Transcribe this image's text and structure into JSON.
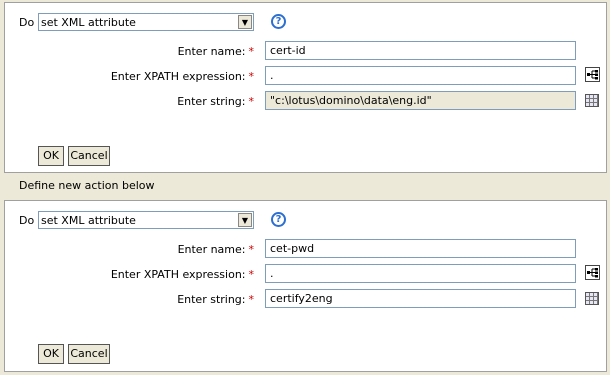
{
  "actions": [
    {
      "do_label": "Do",
      "selected_action": "set XML attribute",
      "help_glyph": "?",
      "fields": {
        "name_label": "Enter name:",
        "name_value": "cert-id",
        "xpath_label": "Enter XPATH expression:",
        "xpath_value": ".",
        "string_label": "Enter string:",
        "string_value": "\"c:\\lotus\\domino\\data\\eng.id\""
      },
      "required_mark": "*",
      "ok_label": "OK",
      "cancel_label": "Cancel"
    },
    {
      "do_label": "Do",
      "selected_action": "set XML attribute",
      "help_glyph": "?",
      "fields": {
        "name_label": "Enter name:",
        "name_value": "cet-pwd",
        "xpath_label": "Enter XPATH expression:",
        "xpath_value": ".",
        "string_label": "Enter string:",
        "string_value": "certify2eng"
      },
      "required_mark": "*",
      "ok_label": "OK",
      "cancel_label": "Cancel"
    }
  ],
  "define_new_action_text": "Define new action below",
  "icons": {
    "help": "help-icon",
    "xpath": "xpath-builder-icon",
    "string": "argument-builder-icon"
  }
}
